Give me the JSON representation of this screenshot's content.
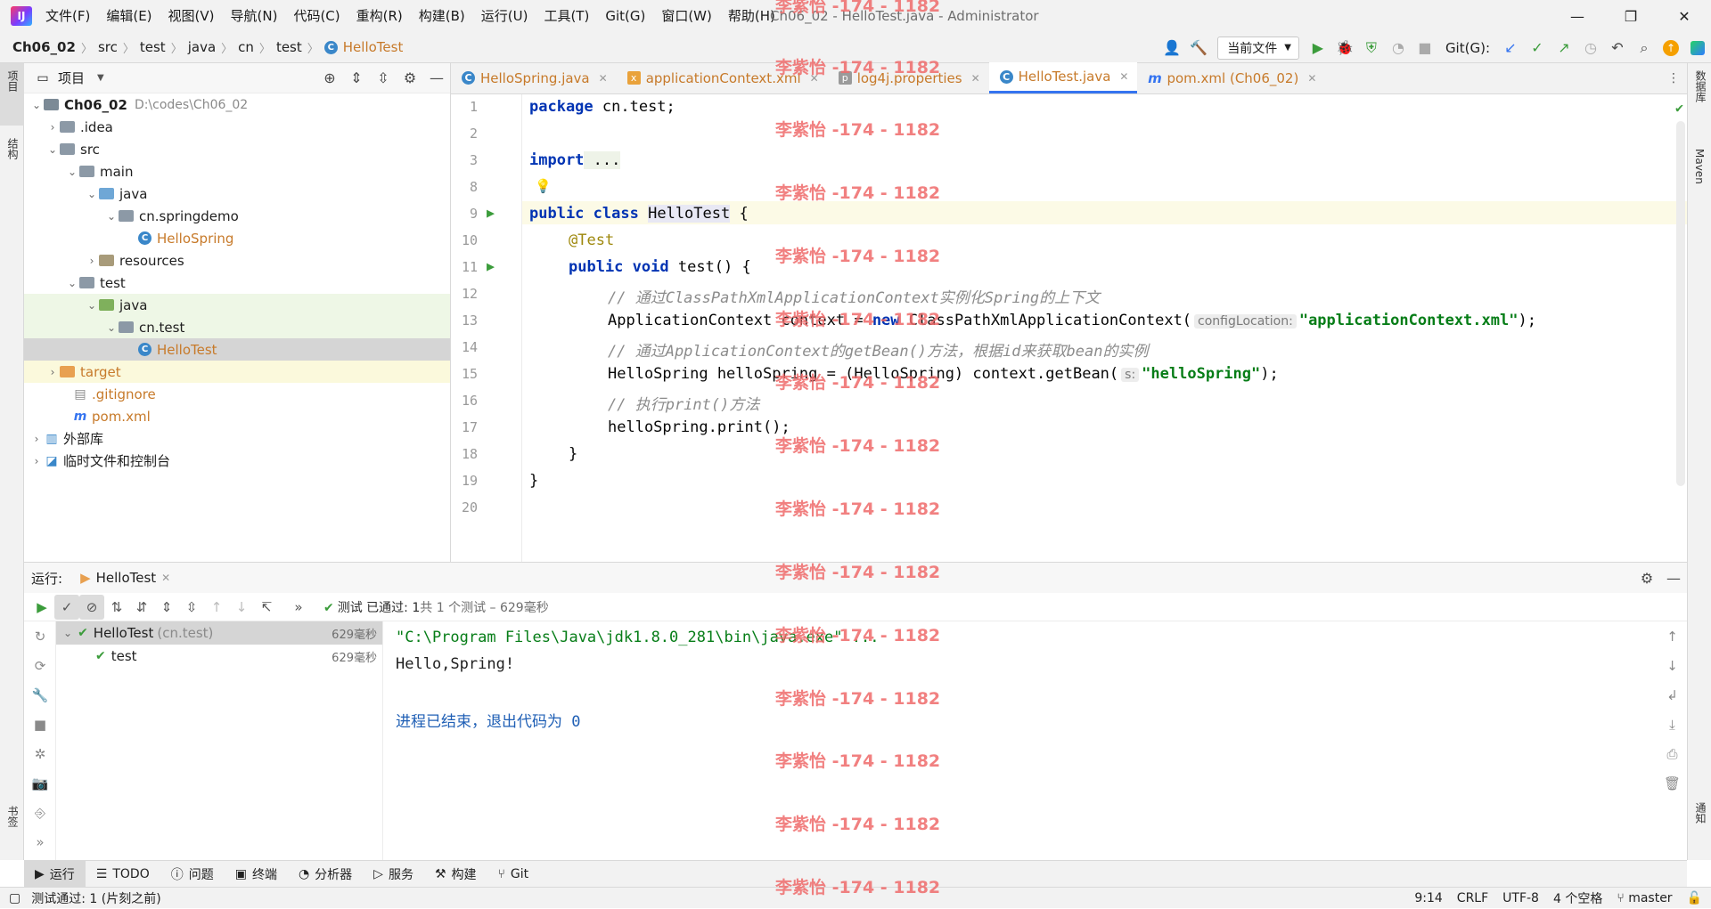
{
  "titlebar": {
    "menu": [
      "文件(F)",
      "编辑(E)",
      "视图(V)",
      "导航(N)",
      "代码(C)",
      "重构(R)",
      "构建(B)",
      "运行(U)",
      "工具(T)",
      "Git(G)",
      "窗口(W)",
      "帮助(H)"
    ],
    "window_title": "Ch06_02 - HelloTest.java - Administrator"
  },
  "navbar": {
    "crumbs": [
      "Ch06_02",
      "src",
      "test",
      "java",
      "cn",
      "test",
      "HelloTest"
    ],
    "run_config": "当前文件",
    "git_label": "Git(G):"
  },
  "left_strip": {
    "project": "项目",
    "structure": "结构",
    "bookmarks": "书签"
  },
  "right_strip": {
    "database": "数据库",
    "maven": "Maven",
    "notifications": "通知"
  },
  "project_panel": {
    "title": "项目",
    "root_name": "Ch06_02",
    "root_path": "D:\\codes\\Ch06_02",
    "nodes": [
      ".idea",
      "src",
      "main",
      "java",
      "cn.springdemo",
      "HelloSpring",
      "resources",
      "test",
      "java",
      "cn.test",
      "HelloTest",
      "target",
      ".gitignore",
      "pom.xml",
      "外部库",
      "临时文件和控制台"
    ]
  },
  "editor_tabs": [
    "HelloSpring.java",
    "applicationContext.xml",
    "log4j.properties",
    "HelloTest.java",
    "pom.xml (Ch06_02)"
  ],
  "editor": {
    "line_numbers": [
      "1",
      "2",
      "3",
      "8",
      "9",
      "10",
      "11",
      "12",
      "13",
      "14",
      "15",
      "16",
      "17",
      "18",
      "19",
      "20"
    ],
    "l1_kw": "package",
    "l1_rest": " cn.test;",
    "l3_kw": "import",
    "l3_rest": " ...",
    "l9_kw1": "public",
    "l9_kw2": "class",
    "l9_cls": "HelloTest",
    "l9_rest": " {",
    "l10": "@Test",
    "l11_kw1": "public",
    "l11_kw2": "void",
    "l11_rest": " test() {",
    "l12": "// 通过ClassPathXmlApplicationContext实例化Spring的上下文",
    "l13_a": "ApplicationContext context = ",
    "l13_kw": "new",
    "l13_b": " ClassPathXmlApplicationContext(",
    "l13_hint": "configLocation:",
    "l13_str": "\"applicationContext.xml\"",
    "l13_end": ");",
    "l14": "// 通过ApplicationContext的getBean()方法，根据id来获取bean的实例",
    "l15_a": "HelloSpring helloSpring = (HelloSpring) context.getBean(",
    "l15_hint": "s:",
    "l15_str": "\"helloSpring\"",
    "l15_end": ");",
    "l16": "// 执行print()方法",
    "l17": "helloSpring.print();",
    "l18": "}",
    "l19": "}"
  },
  "run_panel": {
    "label": "运行:",
    "tab": "HelloTest",
    "status_a": "测试 已通过:",
    "status_b": "1",
    "status_c": "共 1 个测试 – 629毫秒",
    "tree": [
      {
        "name": "HelloTest",
        "sub": "(cn.test)",
        "time": "629毫秒"
      },
      {
        "name": "test",
        "sub": "",
        "time": "629毫秒"
      }
    ],
    "console": [
      "\"C:\\Program Files\\Java\\jdk1.8.0_281\\bin\\java.exe\" ...",
      "Hello,Spring!",
      "",
      "进程已结束，退出代码为 0"
    ]
  },
  "bottom_tabs": [
    "运行",
    "TODO",
    "问题",
    "终端",
    "分析器",
    "服务",
    "构建",
    "Git"
  ],
  "statusbar": {
    "left": "测试通过: 1 (片刻之前)",
    "position": "9:14",
    "line_sep": "CRLF",
    "encoding": "UTF-8",
    "indent": "4 个空格",
    "branch": "master"
  },
  "watermark": "李紫怡 -174 - 1182",
  "colors": {
    "accent": "#3574f0",
    "success": "#3b9c3b",
    "keyword": "#0033b3",
    "string": "#067d17",
    "comment": "#8c8c8c",
    "annotation": "#9e880d",
    "watermark": "#ef6b6b"
  }
}
